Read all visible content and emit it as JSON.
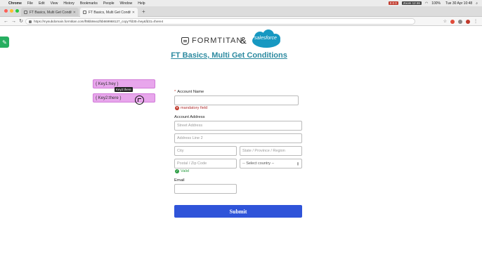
{
  "menubar": {
    "app": "Chrome",
    "items": [
      "File",
      "Edit",
      "View",
      "History",
      "Bookmarks",
      "People",
      "Window",
      "Help"
    ],
    "badge_red": "0 0 0",
    "badge_dark": "Zoom 12:46",
    "battery": "100%",
    "clock": "Tue 30 Apr  10:48"
  },
  "tabs": [
    {
      "label": "FT Basics, Multi Get Conditio",
      "active": false
    },
    {
      "label": "FT Basics, Multi Get Conditio",
      "active": true
    }
  ],
  "address": {
    "url": "https://mysubdomain.formtitan.com/ft9bb8ea1f5b669968127_copy?fd30=hey&fd31=there4"
  },
  "header": {
    "brand": "FORMTITAN",
    "amp": "&",
    "partner": "salesforce",
    "title": "FT Basics, Multi Get Conditions"
  },
  "chips": {
    "key1": "{ Key1:hey }",
    "key2": "{ Key2:there }",
    "tooltip": "Key2:there"
  },
  "form": {
    "account_name_label": "Account Name",
    "required_mark": "*",
    "account_name_value": "",
    "mandatory_msg": "mandatory field",
    "account_address_label": "Account Address",
    "street_placeholder": "Street Address",
    "line2_placeholder": "Address Line 2",
    "city_placeholder": "City",
    "state_placeholder": "State / Province / Region",
    "zip_placeholder": "Postal / Zip Code",
    "country_selected": "-- Select country --",
    "valid_msg": "Valid",
    "email_label": "Email",
    "email_value": "",
    "submit_label": "Submit"
  },
  "colors": {
    "title": "#2c8aa0",
    "submit": "#2f54d9",
    "chip": "#e8a6ec",
    "error": "#c0392b",
    "valid": "#2e9e45",
    "salesforce": "#1798c1",
    "side_tool": "#27ae60"
  },
  "icons": [
    "apple-icon",
    "wrench-icon",
    "lock-icon",
    "error-icon",
    "check-icon",
    "formtitan-shield-icon",
    "salesforce-cloud-icon"
  ]
}
